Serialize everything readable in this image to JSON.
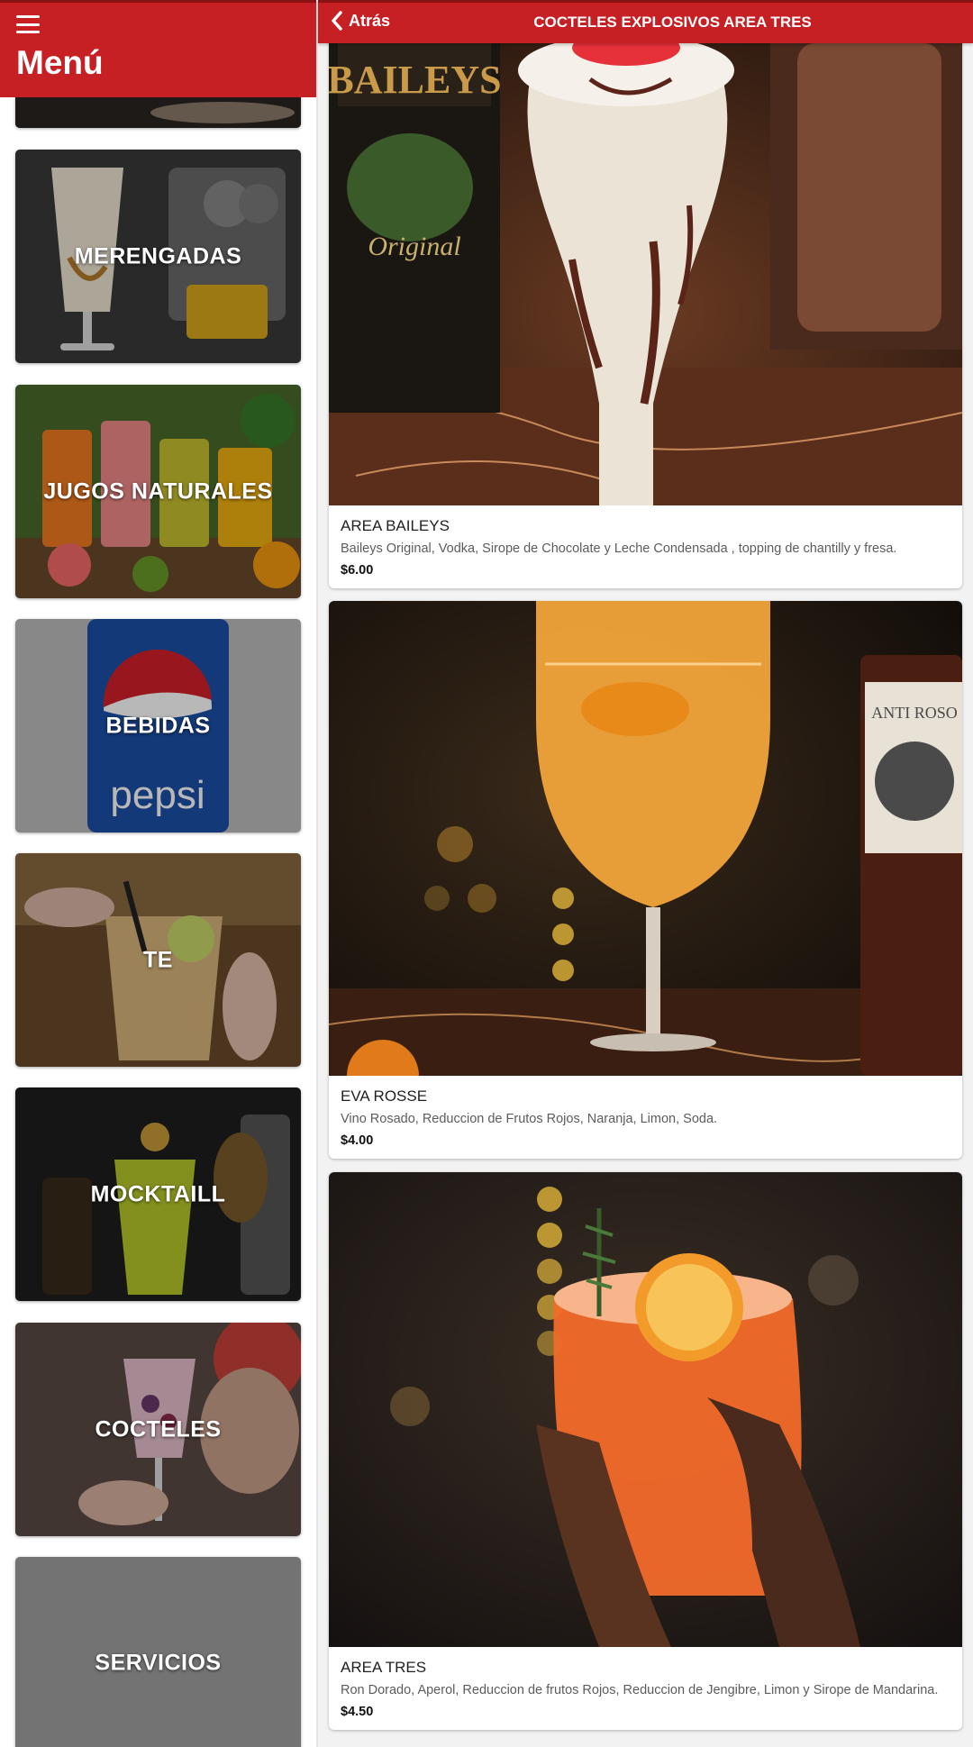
{
  "menu": {
    "title": "Menú",
    "categories": [
      {
        "label": ""
      },
      {
        "label": "MERENGADAS"
      },
      {
        "label": "JUGOS NATURALES"
      },
      {
        "label": "BEBIDAS"
      },
      {
        "label": "TE"
      },
      {
        "label": "MOCKTAILL"
      },
      {
        "label": "COCTELES"
      },
      {
        "label": "SERVICIOS"
      }
    ]
  },
  "header": {
    "back_label": "Atrás",
    "title": "COCTELES EXPLOSIVOS AREA TRES"
  },
  "products": [
    {
      "name": "AREA BAILEYS",
      "description": "Baileys Original, Vodka, Sirope de Chocolate y Leche Condensada , topping de chantilly y fresa.",
      "price": "$6.00"
    },
    {
      "name": "EVA ROSSE",
      "description": "Vino Rosado, Reduccion de Frutos Rojos, Naranja, Limon, Soda.",
      "price": "$4.00"
    },
    {
      "name": "AREA TRES",
      "description": "Ron Dorado, Aperol, Reduccion de frutos Rojos, Reduccion de Jengibre, Limon y Sirope de Mandarina.",
      "price": "$4.50"
    }
  ],
  "image_texts": {
    "baileys_brand": "BAILEYS",
    "baileys_original": "Original",
    "pepsi_logo": "pepsi",
    "wine_label": "ANTI ROSO"
  },
  "colors": {
    "primary": "#c62024",
    "background": "#f2f2f2"
  }
}
